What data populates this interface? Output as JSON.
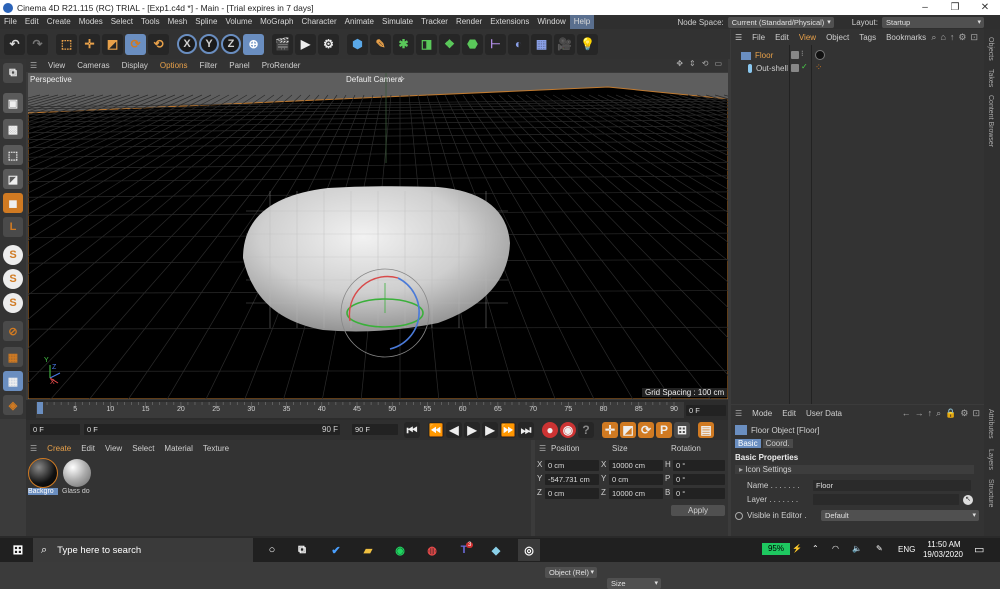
{
  "window": {
    "title": "Cinema 4D R21.115 (RC) TRIAL - [Exp1.c4d *] - Main - [Trial expires in 7 days]",
    "controls": [
      "–",
      "❐",
      "✕"
    ]
  },
  "menu": {
    "items": [
      "File",
      "Edit",
      "Create",
      "Modes",
      "Select",
      "Tools",
      "Mesh",
      "Spline",
      "Volume",
      "MoGraph",
      "Character",
      "Animate",
      "Simulate",
      "Tracker",
      "Render",
      "Extensions",
      "Window",
      "Help"
    ],
    "active": "Help",
    "node_space_label": "Node Space:",
    "node_space_value": "Current (Standard/Physical)",
    "layout_label": "Layout:",
    "layout_value": "Startup"
  },
  "toolbar": {
    "axis_x": "X",
    "axis_y": "Y",
    "axis_z": "Z"
  },
  "viewport": {
    "menu": [
      "View",
      "Cameras",
      "Display",
      "Options",
      "Filter",
      "Panel",
      "ProRender"
    ],
    "active_menu": "Options",
    "name": "Perspective",
    "camera": "Default Camera",
    "camera_icon": "✧",
    "grid_spacing": "Grid Spacing : 100 cm",
    "axis_y": "Y",
    "axis_z": "Z",
    "axis_x": "X",
    "nav_icons": [
      "✥",
      "⇕",
      "⟲",
      "▭"
    ]
  },
  "object_manager": {
    "menu": [
      "File",
      "Edit",
      "View",
      "Object",
      "Tags",
      "Bookmarks"
    ],
    "active_menu": "View",
    "objects": [
      {
        "name": "Floor",
        "selected": true
      },
      {
        "name": "Out-shell",
        "selected": false
      }
    ],
    "right_tabs": [
      "Objects",
      "Takes",
      "Content Browser"
    ],
    "lower_tabs": [
      "Attributes",
      "Layers",
      "Structure"
    ]
  },
  "timeline": {
    "ticks": [
      "0",
      "5",
      "10",
      "15",
      "20",
      "25",
      "30",
      "35",
      "40",
      "45",
      "50",
      "55",
      "60",
      "65",
      "70",
      "75",
      "80",
      "85",
      "90"
    ],
    "current_frame": "0 F",
    "start_frame": "0 F",
    "range_start": "0 F",
    "range_end": "90 F",
    "end_frame": "90 F"
  },
  "material_manager": {
    "menu": [
      "Create",
      "Edit",
      "View",
      "Select",
      "Material",
      "Texture"
    ],
    "materials": [
      {
        "name": "Backgro",
        "selected": true
      },
      {
        "name": "Glass do",
        "selected": false
      }
    ]
  },
  "coordinates": {
    "headers": [
      "Position",
      "Size",
      "Rotation"
    ],
    "rows": [
      {
        "axis": "X",
        "pos": "0 cm",
        "size_axis": "X",
        "size": "10000 cm",
        "rot_axis": "H",
        "rot": "0 °"
      },
      {
        "axis": "Y",
        "pos": "-547.731 cm",
        "size_axis": "Y",
        "size": "0 cm",
        "rot_axis": "P",
        "rot": "0 °"
      },
      {
        "axis": "Z",
        "pos": "0 cm",
        "size_axis": "Z",
        "size": "10000 cm",
        "rot_axis": "B",
        "rot": "0 °"
      }
    ],
    "mode": "Object (Rel)",
    "size_mode": "Size",
    "apply": "Apply"
  },
  "attributes": {
    "menu": [
      "Mode",
      "Edit",
      "User Data"
    ],
    "object_title": "Floor Object [Floor]",
    "tabs": [
      "Basic",
      "Coord."
    ],
    "active_tab": "Basic",
    "section": "Basic Properties",
    "icon_settings": "Icon Settings",
    "name_label": "Name . . . . . . .",
    "name_value": "Floor",
    "layer_label": "Layer . . . . . . .",
    "layer_value": "",
    "visible_label": "Visible in Editor .",
    "visible_value": "Default"
  },
  "taskbar": {
    "search_placeholder": "Type here to search",
    "battery": "95%",
    "language": "ENG",
    "time": "11:50 AM",
    "date": "19/03/2020",
    "badge": "3"
  },
  "colors": {
    "accent_orange": "#d07a22",
    "selection_blue": "#6a8ec0",
    "viewport_bg": "#000000"
  }
}
